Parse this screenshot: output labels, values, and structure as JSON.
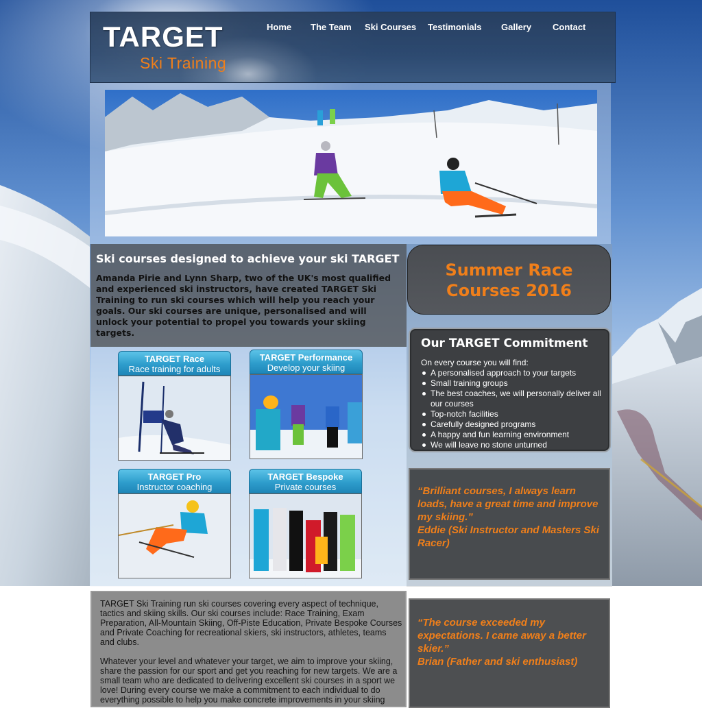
{
  "header": {
    "logo_title": "TARGET",
    "logo_subtitle": "Ski Training"
  },
  "nav": {
    "items": [
      {
        "label": "Home"
      },
      {
        "label": "The Team"
      },
      {
        "label": "Ski Courses"
      },
      {
        "label": "Testimonials"
      },
      {
        "label": "Gallery"
      },
      {
        "label": "Contact"
      }
    ]
  },
  "intro": {
    "heading": "Ski courses designed to achieve your ski TARGET",
    "text": "Amanda Pirie and Lynn Sharp, two of the UK's most qualified and experienced ski instructors, have created TARGET Ski Training to run ski courses which will help you reach your goals. Our ski courses are unique, personalised and will unlock your potential to propel you towards your skiing targets."
  },
  "tiles": [
    {
      "title": "TARGET Race",
      "subtitle": "Race training for adults"
    },
    {
      "title": "TARGET Performance",
      "subtitle": "Develop your skiing"
    },
    {
      "title": "TARGET Pro",
      "subtitle": "Instructor coaching"
    },
    {
      "title": "TARGET Bespoke",
      "subtitle": "Private courses"
    }
  ],
  "body_text": {
    "p1": "TARGET Ski Training run ski courses covering every aspect of technique, tactics and skiing skills. Our ski courses include: Race Training, Exam Preparation, All-Mountain Skiing, Off-Piste Education, Private Bespoke Courses and Private Coaching for recreational skiers, ski instructors, athletes, teams and clubs.",
    "p2": "Whatever your level and whatever your target, we aim to improve your skiing, share the passion for our sport and get you reaching for new targets. We are a small team who are dedicated to delivering excellent ski courses in a sport we love! During every course we make a commitment to each individual to do everything possible to help you make concrete improvements in your skiing"
  },
  "summer": {
    "line1": "Summer Race",
    "line2": "Courses 2016"
  },
  "commitment": {
    "heading": "Our TARGET Commitment",
    "lead": "On every course you will find:",
    "items": [
      "A personalised approach to your targets",
      "Small training groups",
      "The best coaches, we will personally deliver all our courses",
      "Top-notch facilities",
      "Carefully designed programs",
      "A happy and fun learning environment",
      "We will leave no stone unturned"
    ]
  },
  "testimonials": [
    {
      "quote": "“Brilliant courses, I always learn loads, have a great time and improve my skiing.”",
      "author": "Eddie (Ski Instructor and Masters Ski Racer)"
    },
    {
      "quote": "“The course exceeded my expectations. I came away a better skier.”",
      "author": "Brian (Father and ski enthusiast)"
    }
  ],
  "colors": {
    "accent": "#f07f1a",
    "header_bg": "#2c466a",
    "tab_blue": "#2e9dcc",
    "panel_dark": "#3d3f42"
  },
  "icons": [
    "bullet-dot"
  ]
}
